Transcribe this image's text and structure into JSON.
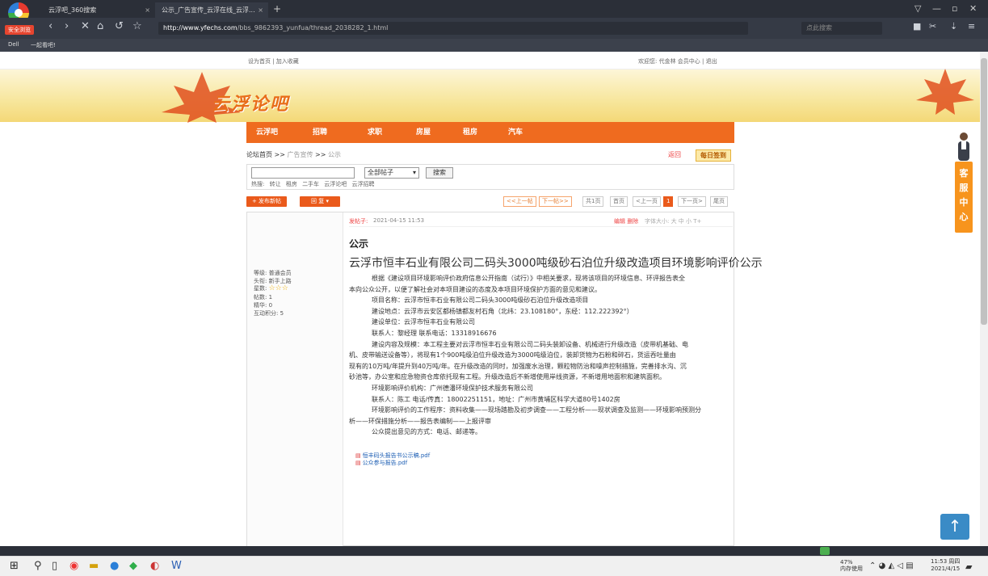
{
  "browser": {
    "logo_tag": "安全浏览",
    "tabs": [
      {
        "label": "云浮吧_360搜索"
      },
      {
        "label": "公示_广告宣传_云浮在线_云浮..."
      }
    ],
    "address": {
      "host": "http://www.yfechs.com",
      "path": "/bbs_9862393_yunfua/thread_2038282_1.html"
    },
    "search_placeholder": "点此搜索",
    "bookmarks": [
      "Dell",
      "一起看吧!"
    ]
  },
  "site": {
    "top_links": "设为首页 | 加入收藏",
    "top_right": "欢迎您: 代金林 会员中心 | 退出",
    "logo_text": "云浮论吧",
    "nav": [
      "云浮吧",
      "招聘",
      "求职",
      "房屋",
      "租房",
      "汽车"
    ],
    "breadcrumb": {
      "home": "论坛首页",
      "sep1": ">>",
      "section": "广告宣传",
      "sep2": ">>",
      "current": "公示"
    },
    "return_label": "返回",
    "sign_label": "每日签到",
    "search": {
      "placeholder": "",
      "select_value": "全部帖子",
      "button": "搜索"
    },
    "hot_label": "热搜:",
    "hot_words": [
      "转让",
      "租房",
      "二手车",
      "云浮论吧",
      "云浮招聘"
    ],
    "actions": {
      "new_post": "+ 发布新帖",
      "reply": "回 复 ▾"
    },
    "pager_prev_next": [
      "<<上一帖",
      "下一帖>>"
    ],
    "pager": [
      "共1页",
      "首页",
      "<上一页",
      "1",
      "下一页>",
      "尾页"
    ]
  },
  "user": {
    "lines": [
      {
        "label": "等级:",
        "value": "普通会员"
      },
      {
        "label": "头衔:",
        "value": "新手上路"
      },
      {
        "label": "星数:",
        "value": "☆☆☆"
      },
      {
        "label": "帖数:",
        "value": "1"
      },
      {
        "label": "精华:",
        "value": "0"
      },
      {
        "label": "互动积分:",
        "value": "5"
      }
    ]
  },
  "post": {
    "author": "发帖子:",
    "date": "2021-04-15 11:53",
    "edit": "编辑  删除",
    "font_size": "字体大小: 大 中 小 T+",
    "title": "公示",
    "headline": "云浮市恒丰石业有限公司二码头3000吨级砂石泊位升级改造项目环境影响评价公示",
    "body": [
      {
        "text": "根据《建设项目环境影响评价政府信息公开指南（试行）》中相关要求，现将该项目的环境信息、环评报告表全",
        "indent": true
      },
      {
        "text": "本向公众公开，以便了解社会对本项目建设的态度及本项目环境保护方面的意见和建议。",
        "indent": false
      },
      {
        "text": "项目名称：云浮市恒丰石业有限公司二码头3000吨级砂石泊位升级改造项目",
        "indent": true
      },
      {
        "text": "建设地点：云浮市云安区都杨镇都友村石角（北纬：23.108180°，东经：112.222392°）",
        "indent": true
      },
      {
        "text": "建设单位：云浮市恒丰石业有限公司",
        "indent": true
      },
      {
        "text": "联系人：黎经理  联系电话：13318916676",
        "indent": true
      },
      {
        "text": "建设内容及规模：本工程主要对云浮市恒丰石业有限公司二码头装卸设备、机械进行升级改造（皮带机基础、电",
        "indent": true
      },
      {
        "text": "机、皮带输送设备等），将现有1个900吨级泊位升级改造为3000吨级泊位，装卸货物为石粉和碎石，货运吞吐量由",
        "indent": false
      },
      {
        "text": "现有的10万吨/年提升到40万吨/年。在升级改造的同时，加强废水治理，颗粒物防治和噪声控制措施，完善排水沟、沉",
        "indent": false
      },
      {
        "text": "砂池等，办公室和应急物资仓库依托现有工程。升级改造后不新增使用岸线资源，不新增用地面积和建筑面积。",
        "indent": false
      },
      {
        "text": "环境影响评价机构：广州德潘环境保护技术服务有限公司",
        "indent": true
      },
      {
        "text": "联系人：陈工  电话/传真：18002251151，地址：广州市黄埔区科学大道80号1402房",
        "indent": true
      },
      {
        "text": "环境影响评价的工作程序：资料收集——现场踏勘及初步调查——工程分析——现状调查及监测——环境影响预测分",
        "indent": true
      },
      {
        "text": "析——环保措施分析——报告表编制——上报评审",
        "indent": false
      },
      {
        "text": "公众提出意见的方式：电话、邮递等。",
        "indent": true
      }
    ],
    "attachments": [
      "恒丰码头报告书公示稿.pdf",
      "公众参与报告.pdf"
    ]
  },
  "side": {
    "service": "客服中心",
    "top_label": "↑"
  },
  "taskbar": {
    "cpu_pct": "47%",
    "cpu_label": "内存使用",
    "time": "11:53 周四",
    "date": "2021/4/15"
  }
}
